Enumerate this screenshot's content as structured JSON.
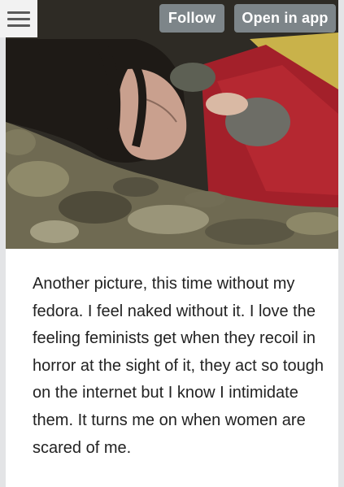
{
  "header": {
    "menu_icon": "hamburger-menu-icon",
    "follow_label": "Follow",
    "open_app_label": "Open in app"
  },
  "photo": {
    "description_icon": "photo-image"
  },
  "post": {
    "text": "Another picture, this time without my fedora. I feel naked without it. I love the feeling feminists get when they recoil in horror at the sight of it, they act so tough on the internet but I know I intimidate them. It turns me on when women are scared of me."
  },
  "colors": {
    "button_bg": "#7d8589",
    "button_text": "#ffffff",
    "page_bg": "#ffffff",
    "outer_bg": "#e3e4e6",
    "text": "#222222"
  }
}
